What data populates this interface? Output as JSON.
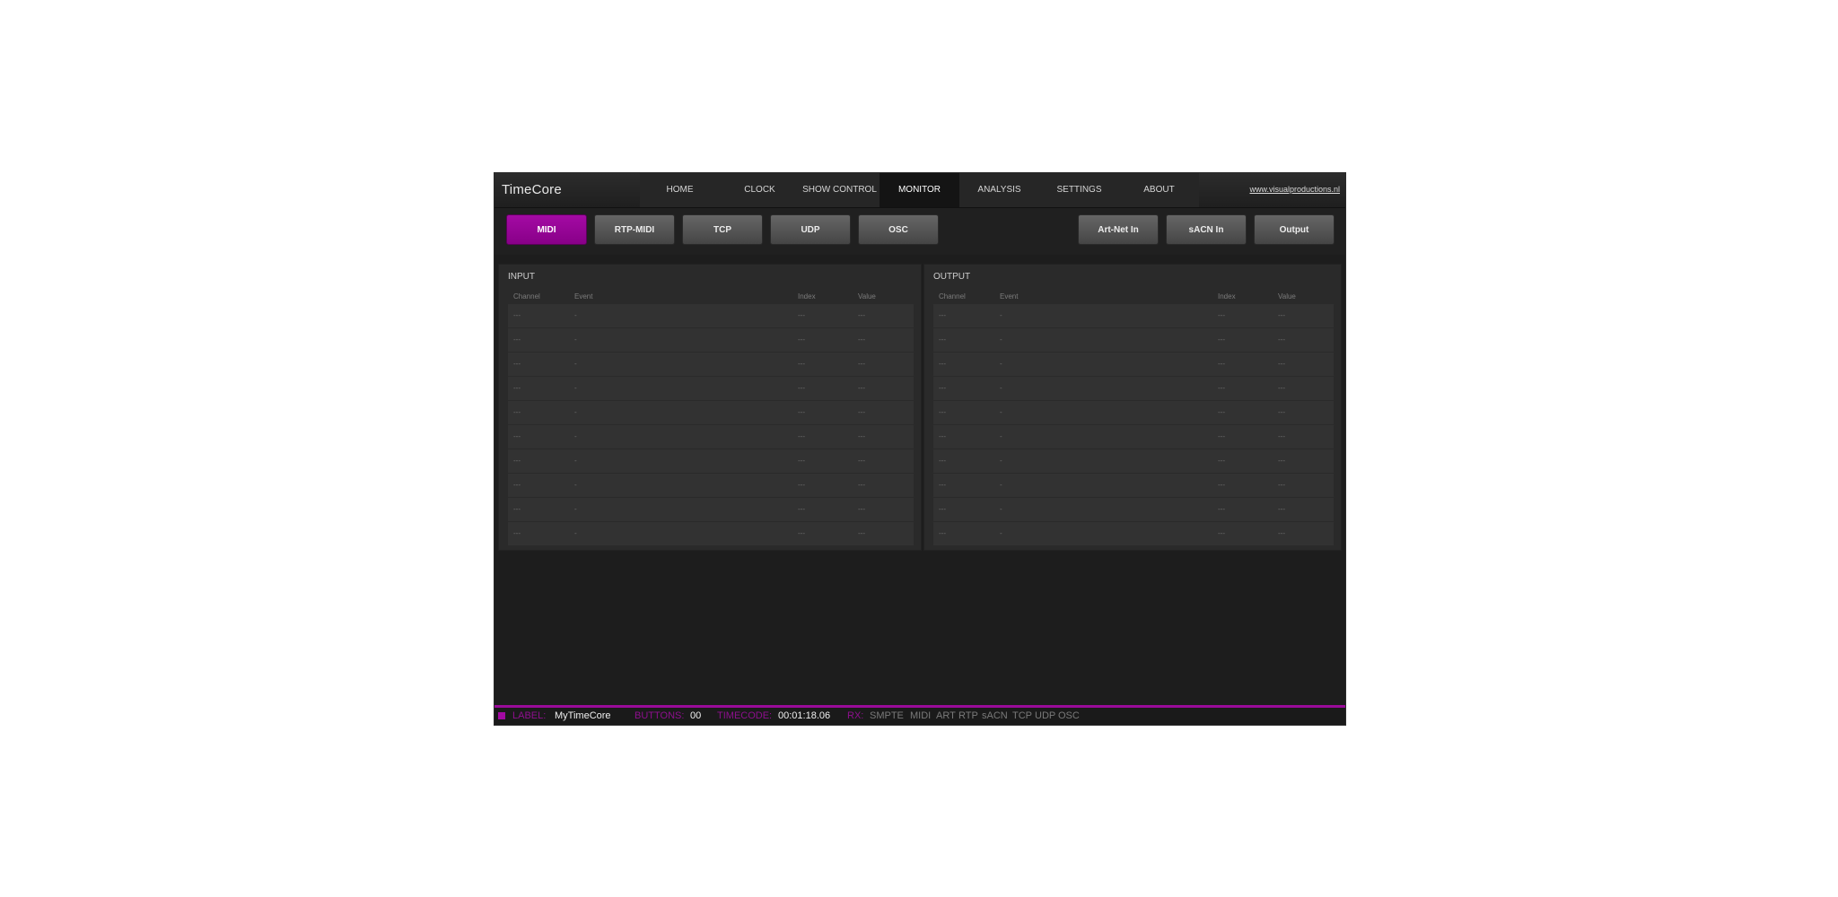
{
  "app": {
    "title": "TimeCore",
    "site_link": "www.visualproductions.nl"
  },
  "nav": {
    "tabs": [
      {
        "label": "HOME"
      },
      {
        "label": "CLOCK"
      },
      {
        "label": "SHOW CONTROL"
      },
      {
        "label": "MONITOR",
        "active": true
      },
      {
        "label": "ANALYSIS"
      },
      {
        "label": "SETTINGS"
      },
      {
        "label": "ABOUT"
      }
    ]
  },
  "toolbar": {
    "left_buttons": [
      {
        "label": "MIDI",
        "active": true
      },
      {
        "label": "RTP-MIDI"
      },
      {
        "label": "TCP"
      },
      {
        "label": "UDP"
      },
      {
        "label": "OSC"
      }
    ],
    "right_buttons": [
      {
        "label": "Art-Net In"
      },
      {
        "label": "sACN In"
      },
      {
        "label": "Output"
      }
    ],
    "accent_color": "#a30aa3"
  },
  "input_panel": {
    "title": "INPUT",
    "columns": [
      "Channel",
      "Event",
      "Index",
      "Value"
    ],
    "rows": [
      [
        "---",
        "-",
        "---",
        "---"
      ],
      [
        "---",
        "-",
        "---",
        "---"
      ],
      [
        "---",
        "-",
        "---",
        "---"
      ],
      [
        "---",
        "-",
        "---",
        "---"
      ],
      [
        "---",
        "-",
        "---",
        "---"
      ],
      [
        "---",
        "-",
        "---",
        "---"
      ],
      [
        "---",
        "-",
        "---",
        "---"
      ],
      [
        "---",
        "-",
        "---",
        "---"
      ],
      [
        "---",
        "-",
        "---",
        "---"
      ],
      [
        "---",
        "-",
        "---",
        "---"
      ]
    ]
  },
  "output_panel": {
    "title": "OUTPUT",
    "columns": [
      "Channel",
      "Event",
      "Index",
      "Value"
    ],
    "rows": [
      [
        "---",
        "-",
        "---",
        "---"
      ],
      [
        "---",
        "-",
        "---",
        "---"
      ],
      [
        "---",
        "-",
        "---",
        "---"
      ],
      [
        "---",
        "-",
        "---",
        "---"
      ],
      [
        "---",
        "-",
        "---",
        "---"
      ],
      [
        "---",
        "-",
        "---",
        "---"
      ],
      [
        "---",
        "-",
        "---",
        "---"
      ],
      [
        "---",
        "-",
        "---",
        "---"
      ],
      [
        "---",
        "-",
        "---",
        "---"
      ],
      [
        "---",
        "-",
        "---",
        "---"
      ]
    ]
  },
  "status": {
    "label_key": "LABEL:",
    "label_value": "MyTimeCore",
    "buttons_key": "BUTTONS:",
    "buttons_value": "00",
    "timecode_key": "TIMECODE:",
    "timecode_value": "00:01:18.06",
    "rx_key": "RX:",
    "rx_items": [
      "SMPTE",
      "MIDI",
      "ART",
      "RTP",
      "sACN",
      "TCP",
      "UDP",
      "OSC"
    ],
    "bar_color": "#9a0b9a"
  }
}
